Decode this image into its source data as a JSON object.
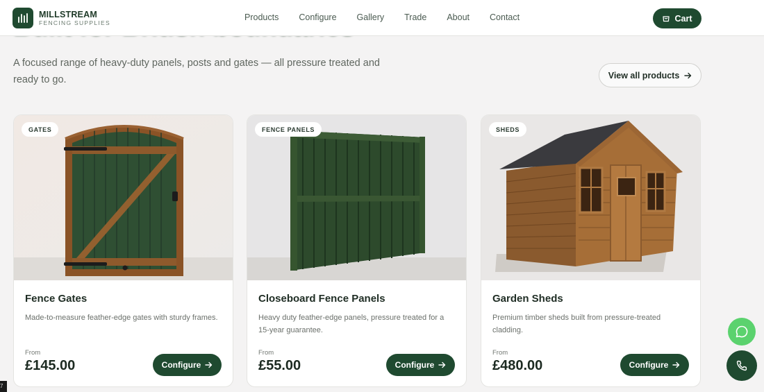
{
  "brand": {
    "name": "MILLSTREAM",
    "tagline": "FENCING SUPPLIES"
  },
  "nav": {
    "items": [
      "Products",
      "Configure",
      "Gallery",
      "Trade",
      "About",
      "Contact"
    ]
  },
  "cart": {
    "label": "Cart"
  },
  "hero": {
    "title": "Built for British boundaries",
    "subtitle": "A focused range of heavy-duty panels, posts and gates — all pressure treated and ready to go.",
    "view_all_label": "View all products"
  },
  "products": [
    {
      "badge": "GATES",
      "title": "Fence Gates",
      "description": "Made-to-measure feather-edge gates with sturdy frames.",
      "from_label": "From",
      "price": "£145.00",
      "button_label": "Configure"
    },
    {
      "badge": "FENCE PANELS",
      "title": "Closeboard Fence Panels",
      "description": "Heavy duty feather-edge panels, pressure treated for a 15-year guarantee.",
      "from_label": "From",
      "price": "£55.00",
      "button_label": "Configure"
    },
    {
      "badge": "SHEDS",
      "title": "Garden Sheds",
      "description": "Premium timber sheds built from pressure-treated cladding.",
      "from_label": "From",
      "price": "£480.00",
      "button_label": "Configure"
    }
  ],
  "corner_tag": "7",
  "colors": {
    "brand_green": "#1f4a30",
    "whatsapp_green": "#5bd26e",
    "page_bg": "#f4f3f3"
  },
  "icons": [
    "logo-bars-icon",
    "cart-icon",
    "arrow-right-icon",
    "whatsapp-icon",
    "phone-icon"
  ]
}
